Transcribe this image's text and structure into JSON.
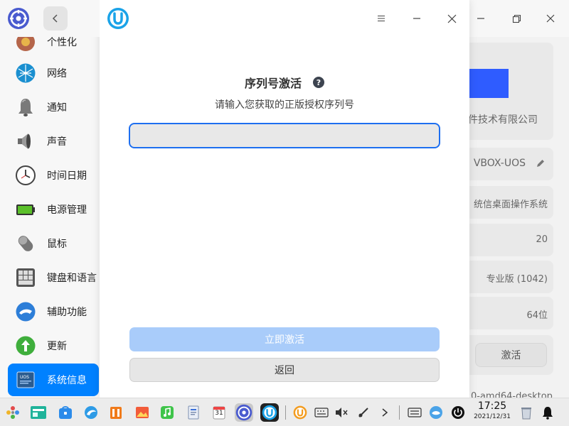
{
  "sidebar": {
    "items": [
      {
        "label": "个性化",
        "icon": "personalization-icon"
      },
      {
        "label": "网络",
        "icon": "network-icon"
      },
      {
        "label": "通知",
        "icon": "bell-icon"
      },
      {
        "label": "声音",
        "icon": "speaker-icon"
      },
      {
        "label": "时间日期",
        "icon": "clock-icon"
      },
      {
        "label": "电源管理",
        "icon": "battery-icon"
      },
      {
        "label": "鼠标",
        "icon": "mouse-icon"
      },
      {
        "label": "键盘和语言",
        "icon": "keyboard-icon"
      },
      {
        "label": "辅助功能",
        "icon": "accessibility-icon"
      },
      {
        "label": "更新",
        "icon": "update-icon"
      },
      {
        "label": "系统信息",
        "icon": "system-info-icon",
        "active": true
      }
    ]
  },
  "dialog": {
    "title": "序列号激活",
    "subtitle": "请输入您获取的正版授权序列号",
    "input_value": "",
    "activate_label": "立即激活",
    "return_label": "返回"
  },
  "system_info": {
    "company": "件技术有限公司",
    "computer_name": "VBOX-UOS",
    "os_name": "统信桌面操作系统",
    "version": "20",
    "edition": "专业版 (1042)",
    "type": "64位",
    "activate_label": "激活",
    "kernel_partial": "0-amd64-desktop"
  },
  "taskbar": {
    "time": "17:25",
    "date": "2021/12/31",
    "calendar_day": "31"
  },
  "colors": {
    "accent": "#0081ff",
    "input_border": "#1e6ff0",
    "activate_button_disabled": "#a9ccfa",
    "logo_blue": "#2f5cff"
  }
}
